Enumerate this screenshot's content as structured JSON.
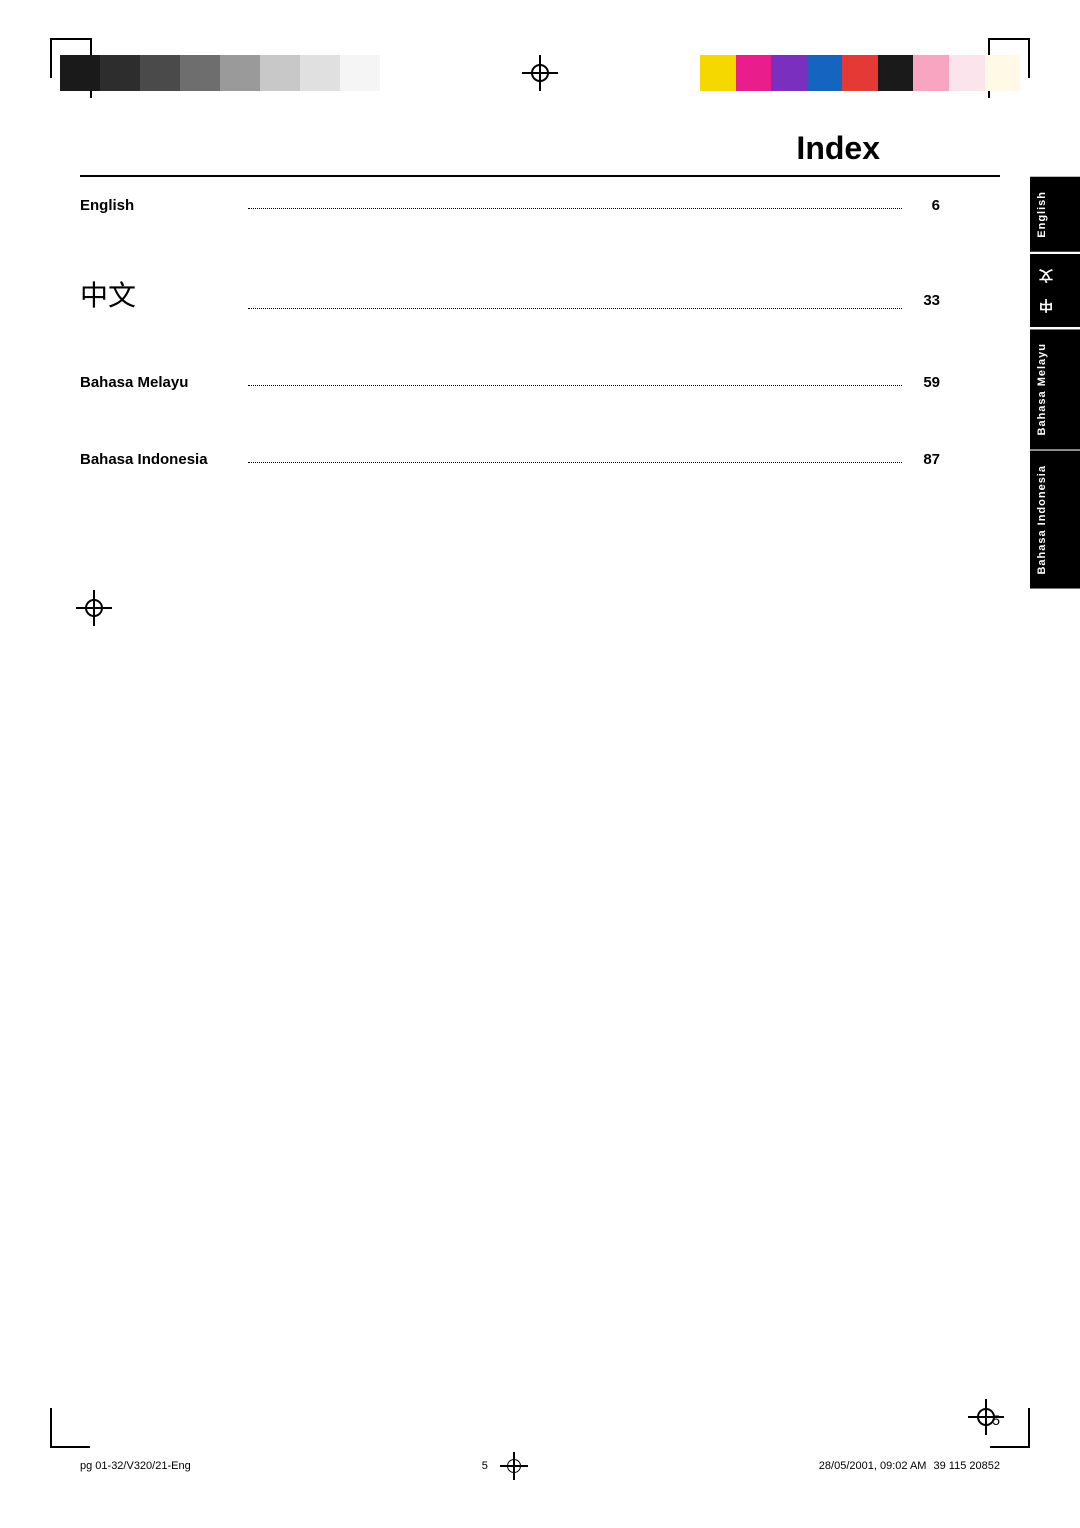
{
  "page": {
    "title": "Index",
    "number": "5"
  },
  "color_strips": {
    "left": [
      {
        "color": "#1a1a1a",
        "label": "black-dark"
      },
      {
        "color": "#2d2d2d",
        "label": "black-medium"
      },
      {
        "color": "#4a4a4a",
        "label": "gray-dark"
      },
      {
        "color": "#6e6e6e",
        "label": "gray-medium"
      },
      {
        "color": "#9a9a9a",
        "label": "gray-light"
      },
      {
        "color": "#c8c8c8",
        "label": "gray-lighter"
      },
      {
        "color": "#e0e0e0",
        "label": "gray-very-light"
      },
      {
        "color": "#f5f5f5",
        "label": "white-off"
      }
    ],
    "right": [
      {
        "color": "#f5d800",
        "label": "yellow"
      },
      {
        "color": "#e91e8c",
        "label": "magenta"
      },
      {
        "color": "#7b2fbe",
        "label": "purple"
      },
      {
        "color": "#1565c0",
        "label": "blue"
      },
      {
        "color": "#e53935",
        "label": "red"
      },
      {
        "color": "#1a1a1a",
        "label": "black"
      },
      {
        "color": "#f8a5c2",
        "label": "pink-light"
      },
      {
        "color": "#fce4ec",
        "label": "pink-very-light"
      },
      {
        "color": "#fff9e6",
        "label": "cream"
      }
    ]
  },
  "index_entries": [
    {
      "label": "English",
      "label_type": "normal",
      "page": "6",
      "tab_text": "English"
    },
    {
      "label": "中文",
      "label_type": "chinese",
      "page": "33",
      "tab_text": "中　文"
    },
    {
      "label": "Bahasa Melayu",
      "label_type": "normal",
      "page": "59",
      "tab_text": "Bahasa Melayu"
    },
    {
      "label": "Bahasa Indonesia",
      "label_type": "normal",
      "page": "87",
      "tab_text": "Bahasa Indonesia"
    }
  ],
  "footer": {
    "left": "pg 01-32/V320/21-Eng",
    "center_page": "5",
    "right": "28/05/2001, 09:02 AM",
    "right_extra": "39 115 20852"
  }
}
